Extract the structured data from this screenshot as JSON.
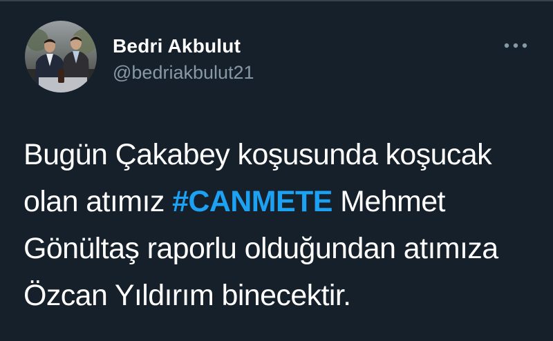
{
  "tweet": {
    "author": {
      "display_name": "Bedri Akbulut",
      "handle": "@bedriakbulut21"
    },
    "more_icon": "more-horizontal-icon",
    "text": {
      "segment_1": "Bugün Çakabey koşusunda koşucak olan atımız ",
      "hashtag": "#CANMETE",
      "segment_2": " Mehmet Gönültaş raporlu olduğundan atımıza Özcan Yıldırım binecektir."
    }
  },
  "colors": {
    "background": "#15202b",
    "primary_text": "#ffffff",
    "secondary_text": "#8899a6",
    "hashtag": "#1da1f2"
  }
}
